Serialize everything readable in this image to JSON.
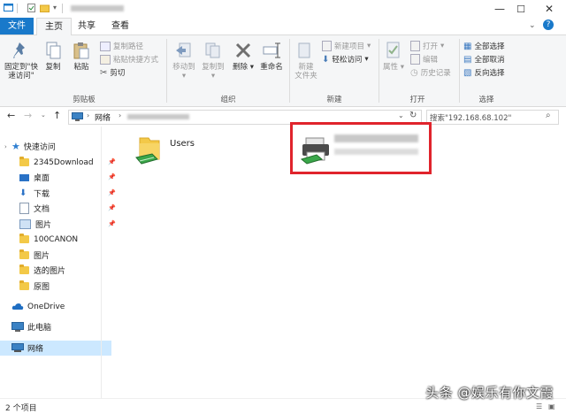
{
  "window": {
    "title_blur": "",
    "controls": {
      "minimize": "—",
      "maximize": "☐",
      "close": "✕"
    }
  },
  "tabs": {
    "file": "文件",
    "home": "主页",
    "share": "共享",
    "view": "查看"
  },
  "ribbon": {
    "clipboard": {
      "pin": "固定到\"快\n速访问\"",
      "copy": "复制",
      "paste": "粘贴",
      "copy_path": "复制路径",
      "paste_shortcut": "粘贴快捷方式",
      "cut": "剪切",
      "label": "剪贴板"
    },
    "organize": {
      "move_to": "移动到",
      "copy_to": "复制到",
      "delete": "删除",
      "rename": "重命名",
      "label": "组织"
    },
    "new": {
      "new_folder": "新建\n文件夹",
      "new_item": "新建项目",
      "easy_access": "轻松访问",
      "label": "新建"
    },
    "open": {
      "properties": "属性",
      "open": "打开",
      "edit": "编辑",
      "history": "历史记录",
      "label": "打开"
    },
    "select": {
      "select_all": "全部选择",
      "select_none": "全部取消",
      "invert": "反向选择",
      "label": "选择"
    }
  },
  "address": {
    "crumb": "网络",
    "search_placeholder": "搜索\"192.168.68.102\""
  },
  "nav": {
    "quick_access": "快速访问",
    "items": [
      {
        "label": "2345Download",
        "pinned": true
      },
      {
        "label": "桌面",
        "pinned": true
      },
      {
        "label": "下载",
        "pinned": true
      },
      {
        "label": "文档",
        "pinned": true
      },
      {
        "label": "图片",
        "pinned": true
      },
      {
        "label": "100CANON",
        "pinned": false
      },
      {
        "label": "图片",
        "pinned": false
      },
      {
        "label": "选的图片",
        "pinned": false
      },
      {
        "label": "原图",
        "pinned": false
      }
    ],
    "onedrive": "OneDrive",
    "this_pc": "此电脑",
    "network": "网络"
  },
  "content": {
    "items": [
      {
        "name": "Users"
      }
    ]
  },
  "status": {
    "count": "2 个项目"
  },
  "watermark": "头条 @娱乐有你文霞",
  "colors": {
    "accent": "#1979ca",
    "highlight": "#e0242c",
    "selection": "#cce8ff"
  }
}
